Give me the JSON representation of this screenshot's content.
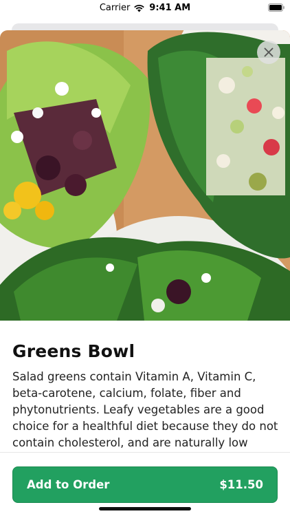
{
  "status_bar": {
    "carrier": "Carrier",
    "time": "9:41 AM"
  },
  "product": {
    "image": "greens-bowl-salad-photo",
    "title": "Greens Bowl",
    "description": "Salad greens contain Vitamin A, Vitamin C, beta-carotene, calcium, folate, fiber and phytonutrients. Leafy vegetables are a good choice for a healthful diet because they do not contain cholesterol, and are naturally low"
  },
  "actions": {
    "close_icon": "close-icon",
    "add_label": "Add to Order",
    "price": "$11.50"
  },
  "colors": {
    "accent": "#22a060",
    "text": "#111111"
  }
}
